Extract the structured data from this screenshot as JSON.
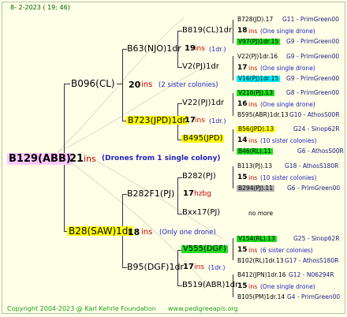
{
  "header": {
    "date": "8-  2-2023 ( 19:  46)"
  },
  "root": {
    "id": "B129(ABB)",
    "ins_num": "21",
    "ins_word": "ins",
    "note": "(Drones from 1 single colony)"
  },
  "gen1": {
    "sire": {
      "id": "B096(CL)",
      "num": "20",
      "ins": "ins",
      "note": "(2 sister colonies)"
    },
    "dam": {
      "id": "B28(SAW)1dr",
      "num": "18",
      "ins": "ins",
      "note": "(Only one drone)"
    }
  },
  "gen2": {
    "a": {
      "id": "B63(NJO)1dr",
      "num": "19",
      "ins": "ins",
      "note": "(1dr.)"
    },
    "b": {
      "id": "B723(JPD)1dr",
      "num": "17",
      "ins": "ins",
      "note": "(1dr.)"
    },
    "c": {
      "id": "B282F1(PJ)",
      "num": "17",
      "ins": "hzbg"
    },
    "d": {
      "id": "B95(DGF)1dr",
      "num": "17",
      "ins": "ins",
      "note": "(1dr.)"
    }
  },
  "gen3": {
    "a": {
      "id": "B819(CL)1dr"
    },
    "b": {
      "id": "V2(PJ)1dr"
    },
    "c": {
      "id": "V22(PJ)1dr"
    },
    "d": {
      "id": "B495(JPD)"
    },
    "e": {
      "id": "B282(PJ)"
    },
    "f": {
      "id": "Bxx17(PJ)"
    },
    "g": {
      "id": "V555(DGF)"
    },
    "h": {
      "id": "B519(ABR)1dr"
    }
  },
  "gen4": [
    {
      "id": "B728(JD).17",
      "code": "G11 - PrimGreen00"
    },
    {
      "num": "18",
      "ins": "ins",
      "note": "(One single drone)"
    },
    {
      "id": "V97(PJ)1dr.15",
      "code": "G9 - PrimGreen00"
    },
    {
      "id": "V22(PJ)1dr.16",
      "code": "G9 - PrimGreen00"
    },
    {
      "num": "17",
      "ins": "ins",
      "note": "(One single drone)"
    },
    {
      "id": "V16(PJ)1dr.15",
      "code": "G9 - PrimGreen00"
    },
    {
      "id": "V216(PJ).13",
      "code": "G8 - PrimGreen00"
    },
    {
      "num": "16",
      "ins": "ins",
      "note": "(One single drone)"
    },
    {
      "id": "B595(ABR)1dr.13",
      "code": "G10 - AthosS00R"
    },
    {
      "id": "B56(JPD).13",
      "code": "G24 - Sinop62R"
    },
    {
      "num": "14",
      "ins": "ins",
      "note": "(10 sister colonies)"
    },
    {
      "id": "B46(RL).11",
      "code": "G6 - AthosS00R"
    },
    {
      "id": "B113(PJ).13",
      "code": "G18 - AthosS180R"
    },
    {
      "num": "15",
      "ins": "ins",
      "note": "(10 sister colonies)"
    },
    {
      "id": "B294(PJ).11",
      "code": "G6 - PrimGreen00"
    },
    {
      "note": "no more"
    },
    {
      "id": "V154(RL).13",
      "code": "G25 - Sinop62R"
    },
    {
      "num": "15",
      "ins": "ins",
      "note": "(6 sister colonies)"
    },
    {
      "id": "B102(RL)1dr.13",
      "code": "G17 - AthosS180R"
    },
    {
      "id": "B412(JPN)1dr.16",
      "code": "G12 - N06294R"
    },
    {
      "num": "15",
      "ins": "ins",
      "note": "(One single drone)"
    },
    {
      "id": "B105(PM)1dr.14",
      "code": "G4 - PrimGreen00"
    }
  ],
  "footer": {
    "copyright": "Copyright 2004-2023 @ Karl Kehrle Foundation",
    "url": "www.pedigreeapis.org"
  },
  "colors": {
    "female_highlight": "#ffc8ff",
    "queen_yellow": "#ffff00",
    "green": "#22dd22",
    "cyan": "#00f0ff",
    "gray": "#b0b0b0"
  }
}
